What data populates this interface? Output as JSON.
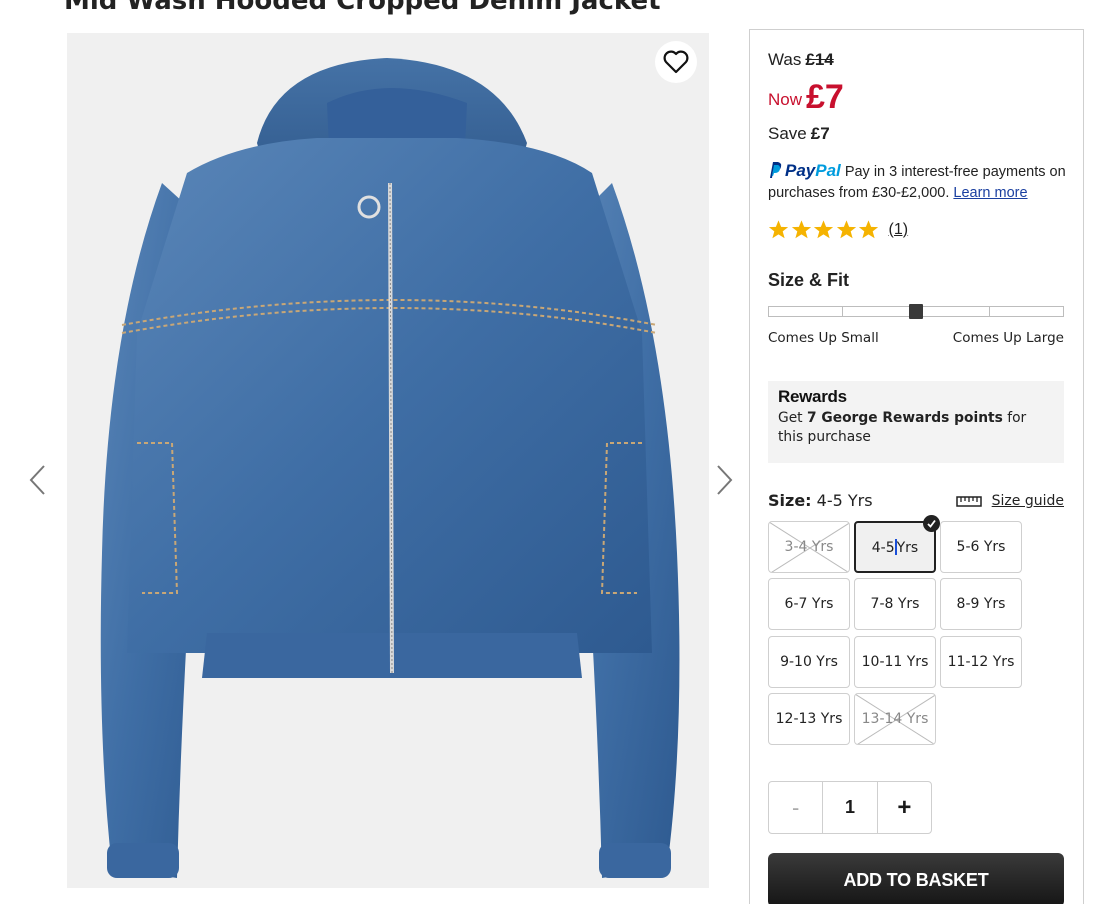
{
  "product": {
    "title": "Mid Wash Hooded Cropped Denim Jacket"
  },
  "price": {
    "was_label": "Was",
    "was_value": "£14",
    "now_label": "Now",
    "now_value": "£7",
    "save_label": "Save",
    "save_value": "£7"
  },
  "paypal": {
    "brand_pay": "Pay",
    "brand_pal": "Pal",
    "text1": "Pay in 3 interest-free payments on purchases from £30-£2,000.",
    "learn_more": "Learn more"
  },
  "rating": {
    "stars": 5,
    "count": "(1)"
  },
  "fit": {
    "title": "Size & Fit",
    "position": 0.5,
    "segments": 4,
    "label_small": "Comes Up Small",
    "label_large": "Comes Up Large"
  },
  "rewards": {
    "title": "Rewards",
    "text_pre": "Get ",
    "text_bold": "7 George Rewards points",
    "text_post": " for this purchase"
  },
  "size": {
    "label": "Size:",
    "selected": "4-5 Yrs",
    "guide": "Size guide",
    "options": [
      {
        "label": "3-4 Yrs",
        "available": false,
        "selected": false
      },
      {
        "label": "4-5 Yrs",
        "available": true,
        "selected": true
      },
      {
        "label": "5-6 Yrs",
        "available": true,
        "selected": false
      },
      {
        "label": "6-7 Yrs",
        "available": true,
        "selected": false
      },
      {
        "label": "7-8 Yrs",
        "available": true,
        "selected": false
      },
      {
        "label": "8-9 Yrs",
        "available": true,
        "selected": false
      },
      {
        "label": "9-10 Yrs",
        "available": true,
        "selected": false
      },
      {
        "label": "10-11 Yrs",
        "available": true,
        "selected": false
      },
      {
        "label": "11-12 Yrs",
        "available": true,
        "selected": false
      },
      {
        "label": "12-13 Yrs",
        "available": true,
        "selected": false
      },
      {
        "label": "13-14 Yrs",
        "available": false,
        "selected": false
      }
    ]
  },
  "quantity": {
    "minus": "-",
    "value": "1",
    "plus": "+"
  },
  "basket": {
    "label": "ADD TO BASKET"
  },
  "colors": {
    "sale_red": "#c8102e",
    "button_dark": "#1f1f1f",
    "star_gold": "#f5b301",
    "paypal_blue": "#003087"
  }
}
